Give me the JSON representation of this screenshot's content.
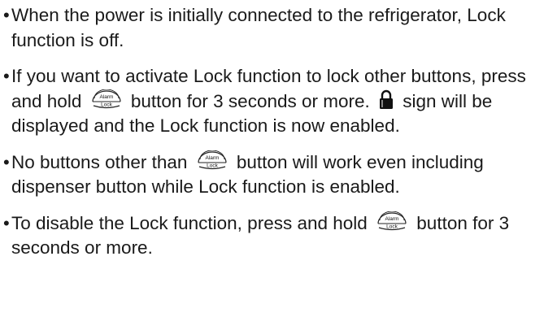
{
  "instructions": [
    {
      "segments": [
        {
          "type": "text",
          "value": "When the power is initially connected to the refrigerator, Lock function is off."
        }
      ]
    },
    {
      "segments": [
        {
          "type": "text",
          "value": "If you want to activate Lock function to lock other buttons, press and hold "
        },
        {
          "type": "icon",
          "icon": "alarm-lock-button-icon"
        },
        {
          "type": "text",
          "value": " button for 3 seconds or more. "
        },
        {
          "type": "icon",
          "icon": "padlock-icon"
        },
        {
          "type": "text",
          "value": " sign will be displayed and the Lock function is now enabled."
        }
      ]
    },
    {
      "segments": [
        {
          "type": "text",
          "value": "No buttons other than "
        },
        {
          "type": "icon",
          "icon": "alarm-lock-button-icon"
        },
        {
          "type": "text",
          "value": " button will work even including dispenser button while Lock function is enabled."
        }
      ]
    },
    {
      "segments": [
        {
          "type": "text",
          "value": "To disable the Lock function, press and hold "
        },
        {
          "type": "icon",
          "icon": "alarm-lock-button-icon"
        },
        {
          "type": "text",
          "value": " button for 3 seconds or more."
        }
      ]
    }
  ],
  "icon_labels": {
    "alarm_lock_top": "Alarm",
    "alarm_lock_bottom": "Lock"
  },
  "bullet_symbol": "•"
}
